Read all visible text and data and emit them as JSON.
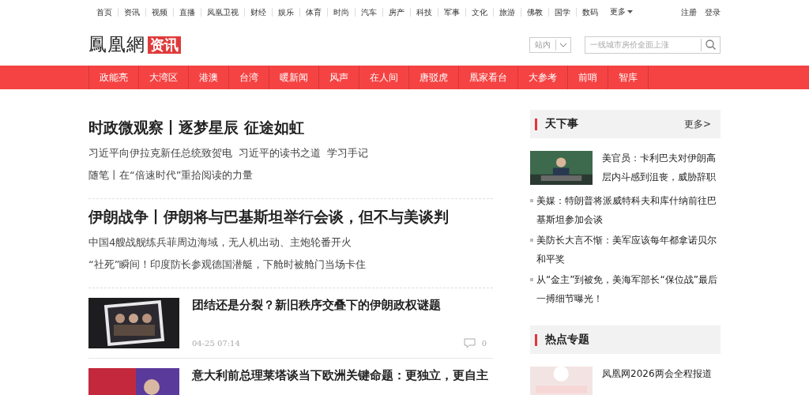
{
  "top_nav": {
    "links": [
      "首页",
      "资讯",
      "视频",
      "直播",
      "凤凰卫视",
      "财经",
      "娱乐",
      "体育",
      "时尚",
      "汽车",
      "房产",
      "科技",
      "军事",
      "文化",
      "旅游",
      "佛教",
      "国学",
      "数码"
    ],
    "more": "更多",
    "account": [
      "注册",
      "登录"
    ]
  },
  "header": {
    "logo": "鳳凰網",
    "channel": "资讯",
    "scope": "站内",
    "placeholder": "一线城市房价全面上涨"
  },
  "channel_nav": [
    "政能亮",
    "大湾区",
    "港澳",
    "台湾",
    "暖新闻",
    "风声",
    "在人间",
    "唐驳虎",
    "凰家看台",
    "大参考",
    "前哨",
    "智库"
  ],
  "headlines": [
    {
      "title": "时政微观察丨逐梦星辰 征途如虹",
      "lines": [
        [
          "习近平向伊拉克新任总统致贺电",
          "习近平的读书之道",
          "学习手记"
        ],
        [
          "随笔丨在“倍速时代”重拾阅读的力量"
        ]
      ]
    },
    {
      "title": "伊朗战争丨伊朗将与巴基斯坦举行会谈，但不与美谈判",
      "lines": [
        [
          "中国4艘战舰练兵菲周边海域，无人机出动、主炮轮番开火"
        ],
        [
          "“社死”瞬间！印度防长参观德国潜艇，下舱时被舱门当场卡住"
        ]
      ]
    }
  ],
  "articles": [
    {
      "kind": "picture",
      "title": "团结还是分裂？新旧秩序交叠下的伊朗政权谜题",
      "time": "04-25 07:14",
      "comments": "0"
    },
    {
      "kind": "picture",
      "title": "意大利前总理莱塔谈当下欧洲关键命题：更独立，更自主"
    }
  ],
  "sidebar": [
    {
      "title": "天下事",
      "more": "更多>",
      "lead": {
        "kind": "picture",
        "title": "美官员：卡利巴夫对伊朗高层内斗感到沮丧，威胁辞职"
      },
      "items": [
        "美媒：特朗普将派威特科夫和库什纳前往巴基斯坦参加会谈",
        "美防长大言不惭：美军应该每年都拿诺贝尔和平奖",
        "从“金主”到被免，美海军部长“保位战”最后一搏细节曝光！"
      ]
    },
    {
      "title": "热点专题",
      "lead": {
        "kind": "picture",
        "title": "凤凰网2026两会全程报道"
      }
    }
  ]
}
